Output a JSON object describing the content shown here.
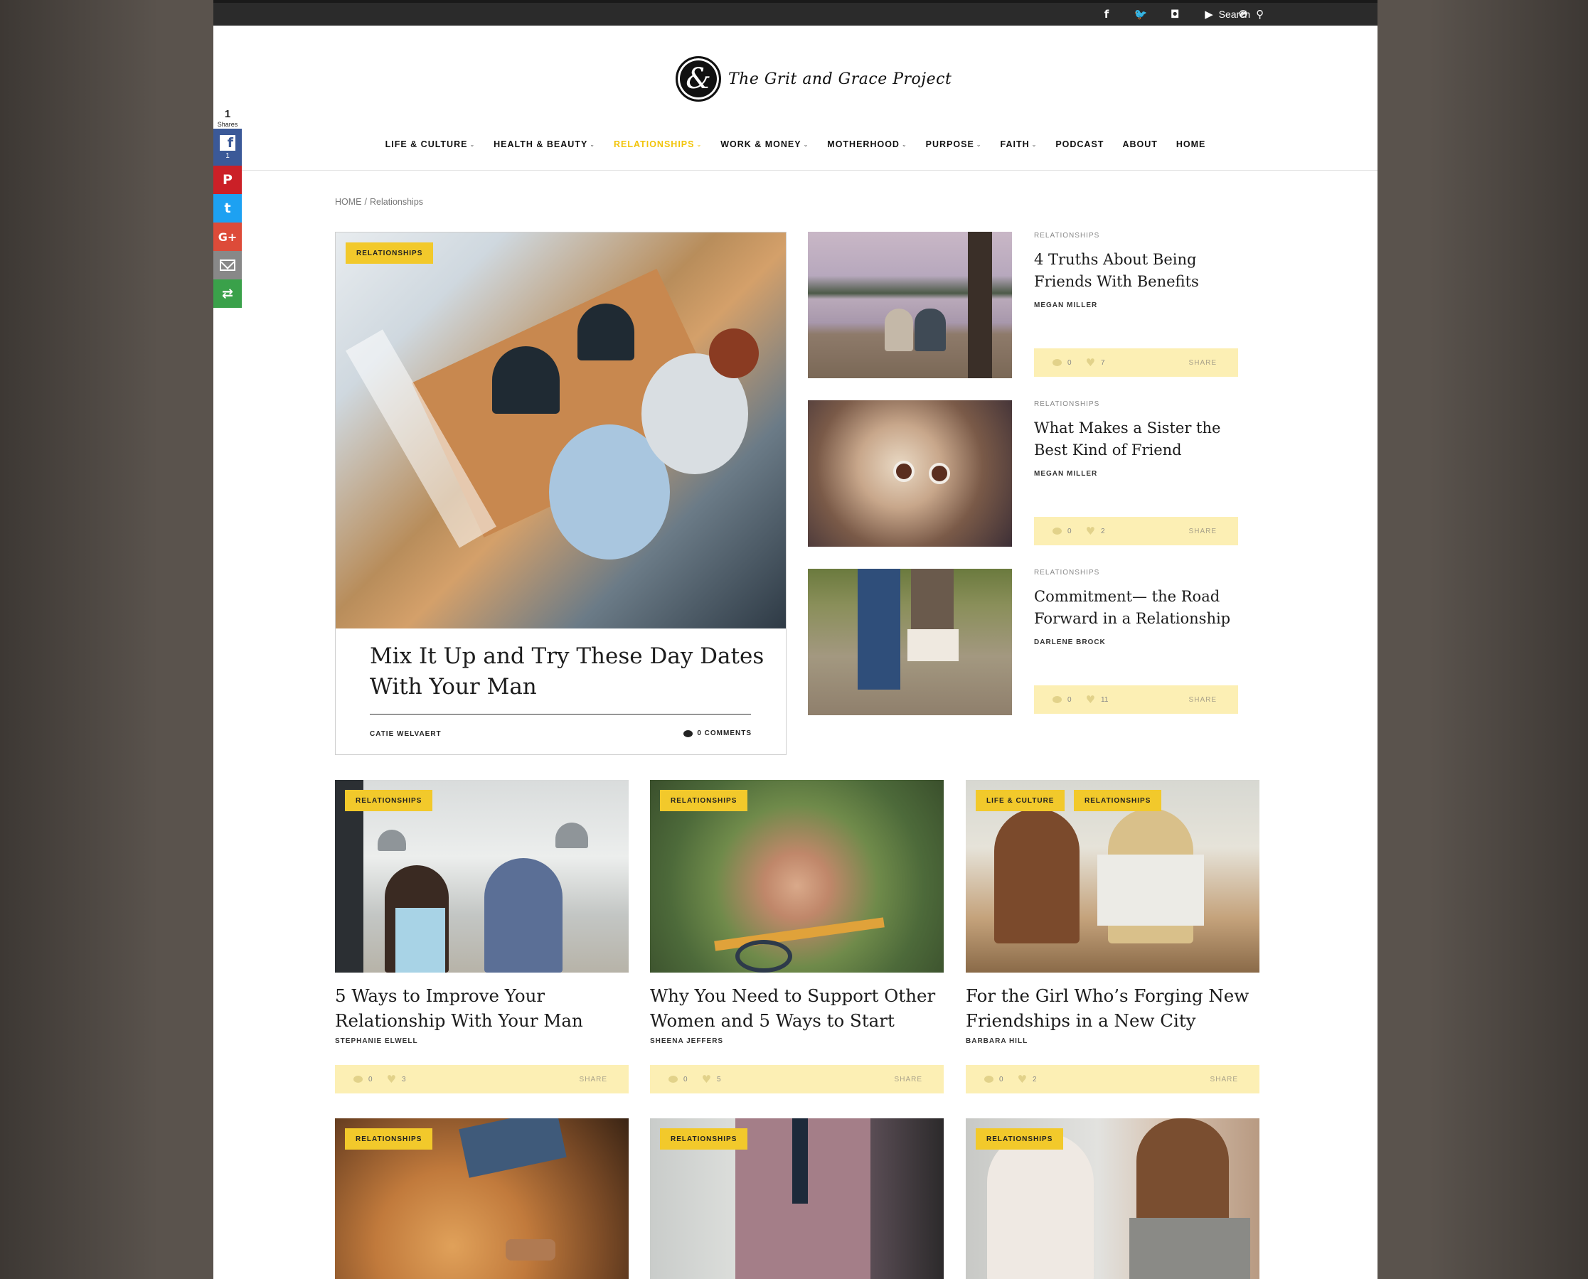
{
  "topbar": {
    "social": [
      {
        "name": "facebook-icon",
        "glyph": "f"
      },
      {
        "name": "twitter-icon",
        "glyph": "🐦"
      },
      {
        "name": "instagram-icon",
        "glyph": "◘"
      },
      {
        "name": "youtube-icon",
        "glyph": "▶"
      },
      {
        "name": "pinterest-icon",
        "glyph": "℗"
      }
    ],
    "search_label": "Search"
  },
  "logo": {
    "mark": "&",
    "text": "The Grit and Grace Project"
  },
  "nav": [
    {
      "label": "LIFE & CULTURE",
      "dropdown": true,
      "active": false
    },
    {
      "label": "HEALTH & BEAUTY",
      "dropdown": true,
      "active": false
    },
    {
      "label": "RELATIONSHIPS",
      "dropdown": true,
      "active": true
    },
    {
      "label": "WORK & MONEY",
      "dropdown": true,
      "active": false
    },
    {
      "label": "MOTHERHOOD",
      "dropdown": true,
      "active": false
    },
    {
      "label": "PURPOSE",
      "dropdown": true,
      "active": false
    },
    {
      "label": "FAITH",
      "dropdown": true,
      "active": false
    },
    {
      "label": "PODCAST",
      "dropdown": false,
      "active": false
    },
    {
      "label": "ABOUT",
      "dropdown": false,
      "active": false
    },
    {
      "label": "HOME",
      "dropdown": false,
      "active": false
    }
  ],
  "breadcrumb": {
    "home": "HOME",
    "separator": "/",
    "current": "Relationships"
  },
  "share_sidebar": {
    "count": "1",
    "count_label": "Shares",
    "facebook_count": "1",
    "facebook_glyph": "f",
    "pinterest_glyph": "P",
    "twitter_glyph": "t",
    "googleplus_glyph": "G+",
    "more_glyph": "⇄"
  },
  "featured": {
    "tag": "RELATIONSHIPS",
    "title": "Mix It Up and Try These Day Dates With Your Man",
    "author": "CATIE WELVAERT",
    "comments": "0 COMMENTS"
  },
  "side_articles": [
    {
      "category": "RELATIONSHIPS",
      "title": "4 Truths About Being Friends With Benefits",
      "author": "MEGAN MILLER",
      "comments": "0",
      "likes": "7",
      "share": "SHARE"
    },
    {
      "category": "RELATIONSHIPS",
      "title": "What Makes a Sister the Best Kind of Friend",
      "author": "MEGAN MILLER",
      "comments": "0",
      "likes": "2",
      "share": "SHARE"
    },
    {
      "category": "RELATIONSHIPS",
      "title": "Commitment— the Road Forward in a Relationship",
      "author": "DARLENE BROCK",
      "comments": "0",
      "likes": "11",
      "share": "SHARE"
    }
  ],
  "grid_articles": [
    {
      "tags": [
        "RELATIONSHIPS"
      ],
      "title": "5 Ways to Improve Your Relationship With Your Man",
      "author": "STEPHANIE ELWELL",
      "comments": "0",
      "likes": "3",
      "share": "SHARE"
    },
    {
      "tags": [
        "RELATIONSHIPS"
      ],
      "title": "Why You Need to Support Other Women and 5 Ways to Start",
      "author": "SHEENA JEFFERS",
      "comments": "0",
      "likes": "5",
      "share": "SHARE"
    },
    {
      "tags": [
        "LIFE & CULTURE",
        "RELATIONSHIPS"
      ],
      "title": "For the Girl Who’s Forging New Friendships in a New City",
      "author": "BARBARA HILL",
      "comments": "0",
      "likes": "2",
      "share": "SHARE"
    }
  ],
  "bottom_articles": [
    {
      "tags": [
        "RELATIONSHIPS"
      ]
    },
    {
      "tags": [
        "RELATIONSHIPS"
      ]
    },
    {
      "tags": [
        "RELATIONSHIPS"
      ]
    }
  ],
  "colors": {
    "accent": "#f2c40a",
    "tag_bg": "#f2c92b",
    "metabar_bg": "#fcefb4"
  }
}
